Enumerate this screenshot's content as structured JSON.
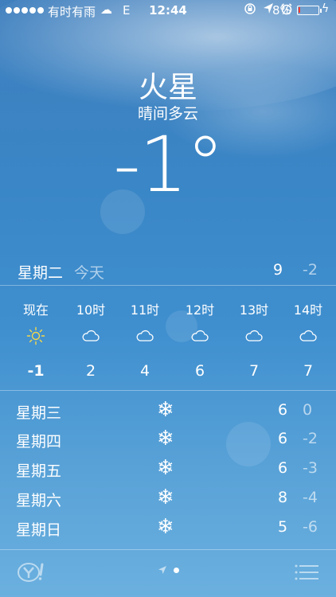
{
  "status_bar": {
    "carrier": "有时有雨",
    "network": "E",
    "time": "12:44",
    "battery_percent": "8%",
    "battery_level": 0.08,
    "battery_color": "#ff3b30"
  },
  "header": {
    "city": "火星",
    "condition": "晴间多云",
    "temperature": "-1°"
  },
  "today": {
    "day": "星期二",
    "label": "今天",
    "high": "9",
    "low": "-2"
  },
  "hourly": [
    {
      "time": "现在",
      "icon": "sun-icon",
      "temp": "-1"
    },
    {
      "time": "10时",
      "icon": "cloud-icon",
      "temp": "2"
    },
    {
      "time": "11时",
      "icon": "cloud-icon",
      "temp": "4"
    },
    {
      "time": "12时",
      "icon": "cloud-icon",
      "temp": "6"
    },
    {
      "time": "13时",
      "icon": "cloud-icon",
      "temp": "7"
    },
    {
      "time": "14时",
      "icon": "cloud-icon",
      "temp": "7"
    }
  ],
  "forecast": [
    {
      "day": "星期三",
      "icon": "snowflake-icon",
      "high": "6",
      "low": "0"
    },
    {
      "day": "星期四",
      "icon": "snowflake-icon",
      "high": "6",
      "low": "-2"
    },
    {
      "day": "星期五",
      "icon": "snowflake-icon",
      "high": "6",
      "low": "-3"
    },
    {
      "day": "星期六",
      "icon": "snowflake-icon",
      "high": "8",
      "low": "-4"
    },
    {
      "day": "星期日",
      "icon": "snowflake-icon",
      "high": "5",
      "low": "-6"
    }
  ],
  "glyphs": {
    "snowflake": "❄",
    "cloud_status": "☁",
    "bolt": "ϟ"
  },
  "colors": {
    "sun": "#f5d84a",
    "text_dim": "rgba(255,255,255,0.6)"
  }
}
